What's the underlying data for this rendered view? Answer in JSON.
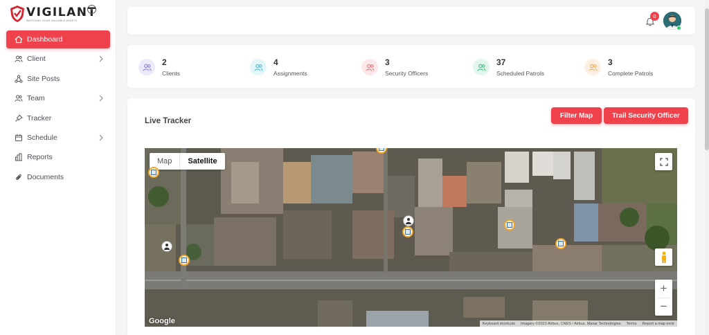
{
  "brand": {
    "name": "VIGILANT",
    "tagline": "WATCHING YOUR VALUABLE ASSETS",
    "accent": "#f0424c"
  },
  "sidebar": {
    "items": [
      {
        "label": "Dashboard",
        "icon": "home-icon",
        "active": true,
        "has_submenu": false
      },
      {
        "label": "Client",
        "icon": "users-icon",
        "active": false,
        "has_submenu": true
      },
      {
        "label": "Site Posts",
        "icon": "network-icon",
        "active": false,
        "has_submenu": false
      },
      {
        "label": "Team",
        "icon": "team-icon",
        "active": false,
        "has_submenu": true
      },
      {
        "label": "Tracker",
        "icon": "pin-icon",
        "active": false,
        "has_submenu": false
      },
      {
        "label": "Schedule",
        "icon": "calendar-icon",
        "active": false,
        "has_submenu": true
      },
      {
        "label": "Reports",
        "icon": "bar-chart-icon",
        "active": false,
        "has_submenu": false
      },
      {
        "label": "Documents",
        "icon": "paperclip-icon",
        "active": false,
        "has_submenu": false
      }
    ]
  },
  "header": {
    "notifications_count": "0"
  },
  "stats": [
    {
      "value": "2",
      "label": "Clients",
      "color": "#ece9fb",
      "icon_color": "#8b7fd6"
    },
    {
      "value": "4",
      "label": "Assignments",
      "color": "#e3f7fb",
      "icon_color": "#3cbfd6"
    },
    {
      "value": "3",
      "label": "Security Officers",
      "color": "#fde8ea",
      "icon_color": "#f0727a"
    },
    {
      "value": "37",
      "label": "Scheduled Patrols",
      "color": "#e2f7ec",
      "icon_color": "#34c07a"
    },
    {
      "value": "3",
      "label": "Complete Patrols",
      "color": "#fdf0e3",
      "icon_color": "#f0a85a"
    }
  ],
  "tracker": {
    "title": "Live Tracker",
    "filter_button": "Filter Map",
    "trail_button": "Trail Security Officer",
    "map": {
      "type_map": "Map",
      "type_satellite": "Satellite",
      "selected_type": "Satellite",
      "logo": "Google",
      "attribution": [
        "Keyboard shortcuts",
        "Imagery ©2023 Airbus, CNES / Airbus, Maxar Technologies",
        "Terms",
        "Report a map error"
      ]
    }
  }
}
